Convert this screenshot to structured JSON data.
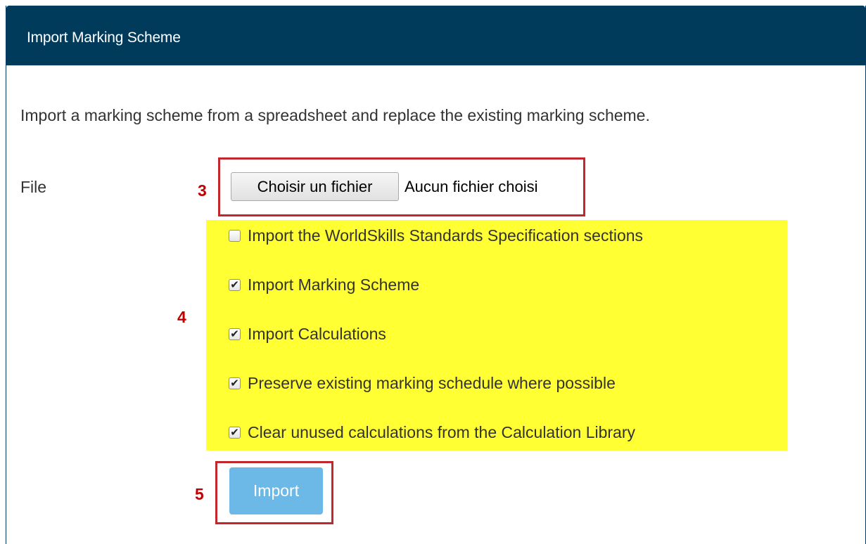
{
  "panel": {
    "title": "Import Marking Scheme",
    "description": "Import a marking scheme from a spreadsheet and replace the existing marking scheme.",
    "accent_color": "#003b5c"
  },
  "file": {
    "label": "File",
    "button_label": "Choisir un fichier",
    "status": "Aucun fichier choisi"
  },
  "steps": {
    "file": "3",
    "options": "4",
    "import": "5"
  },
  "highlight_color": "#ffff33",
  "annotation_color": "#c1272d",
  "options": [
    {
      "label": "Import the WorldSkills Standards Specification sections",
      "checked": false
    },
    {
      "label": "Import Marking Scheme",
      "checked": true
    },
    {
      "label": "Import Calculations",
      "checked": true
    },
    {
      "label": "Preserve existing marking schedule where possible",
      "checked": true
    },
    {
      "label": "Clear unused calculations from the Calculation Library",
      "checked": true
    }
  ],
  "import_button": {
    "label": "Import",
    "color": "#6cb8e6"
  }
}
